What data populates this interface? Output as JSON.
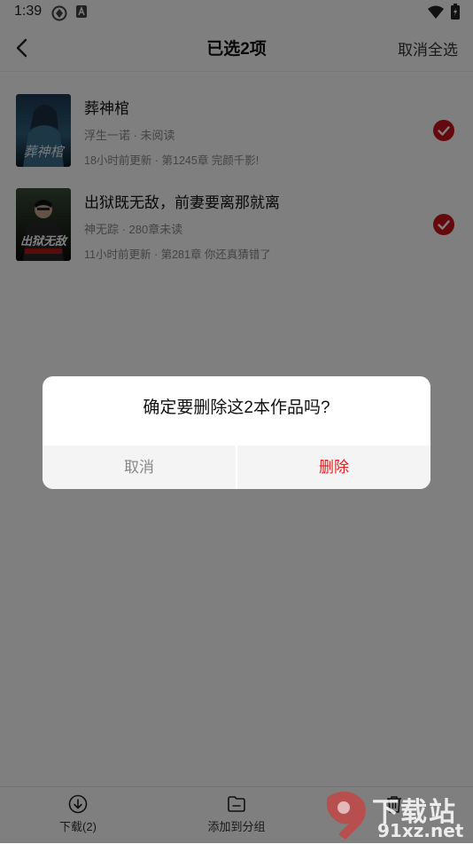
{
  "status_bar": {
    "time": "1:39"
  },
  "header": {
    "title": "已选2项",
    "select_all_label": "取消全选"
  },
  "books": [
    {
      "title": "葬神棺",
      "meta": "浮生一诺 · 未阅读",
      "update": "18小时前更新 · 第1245章 完颜千影!",
      "selected": true
    },
    {
      "title": "出狱既无敌，前妻要离那就离",
      "meta": "神无踪 · 280章未读",
      "update": "11小时前更新 · 第281章 你还真猜错了",
      "selected": true
    }
  ],
  "toolbar": {
    "download_label": "下载(2)",
    "add_group_label": "添加到分组"
  },
  "dialog": {
    "message": "确定要删除这2本作品吗?",
    "cancel_label": "取消",
    "delete_label": "删除"
  },
  "watermark": {
    "line1": "下载站",
    "line2": "91xz.net"
  },
  "colors": {
    "accent": "#e02020",
    "check": "#c8141e"
  },
  "icons": [
    "back-arrow-icon",
    "download-icon",
    "folder-add-icon",
    "trash-icon",
    "check-circle-icon",
    "wifi-icon",
    "battery-icon"
  ]
}
